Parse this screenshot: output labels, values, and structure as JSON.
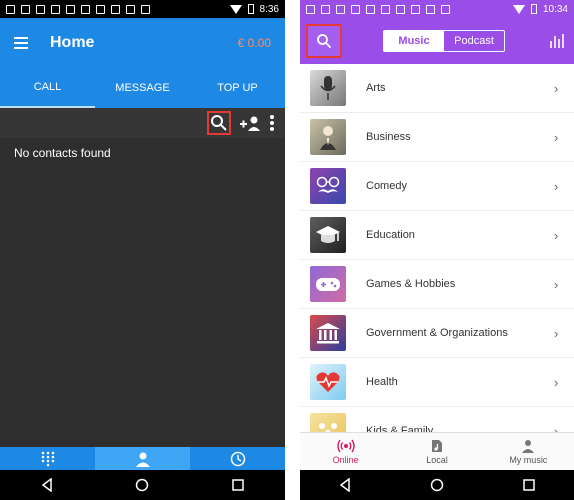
{
  "left": {
    "status_time": "8:36",
    "app_title": "Home",
    "balance": "€ 0.00",
    "tabs": [
      {
        "label": "CALL",
        "active": true
      },
      {
        "label": "MESSAGE",
        "active": false
      },
      {
        "label": "TOP UP",
        "active": false
      }
    ],
    "toolbar_icons": [
      "search-icon",
      "add-contact-icon",
      "more-vert-icon"
    ],
    "empty_message": "No contacts found",
    "bottom_tabs": [
      "dialpad-icon",
      "contacts-icon",
      "history-icon"
    ],
    "colors": {
      "primary": "#1e88e5",
      "balance": "#ff8a5c",
      "background": "#2e2e2e",
      "highlight": "#e53935"
    }
  },
  "right": {
    "status_time": "10:34",
    "segment": {
      "music": "Music",
      "podcast": "Podcast",
      "selected": "Music"
    },
    "categories": [
      {
        "label": "Arts",
        "icon": "microphone-icon"
      },
      {
        "label": "Business",
        "icon": "businessman-icon"
      },
      {
        "label": "Comedy",
        "icon": "glasses-mustache-icon"
      },
      {
        "label": "Education",
        "icon": "graduation-cap-icon"
      },
      {
        "label": "Games & Hobbies",
        "icon": "gamepad-icon"
      },
      {
        "label": "Government & Organizations",
        "icon": "government-building-icon"
      },
      {
        "label": "Health",
        "icon": "heartbeat-icon"
      },
      {
        "label": "Kids & Family",
        "icon": "family-icon"
      }
    ],
    "bottom_tabs": [
      {
        "label": "Online",
        "icon": "broadcast-icon",
        "active": true
      },
      {
        "label": "Local",
        "icon": "music-file-icon",
        "active": false
      },
      {
        "label": "My music",
        "icon": "person-icon",
        "active": false
      }
    ],
    "colors": {
      "primary": "#9b4de8",
      "active_tab": "#d81b60"
    }
  },
  "nav_buttons": [
    "back-icon",
    "home-icon",
    "recents-icon"
  ]
}
